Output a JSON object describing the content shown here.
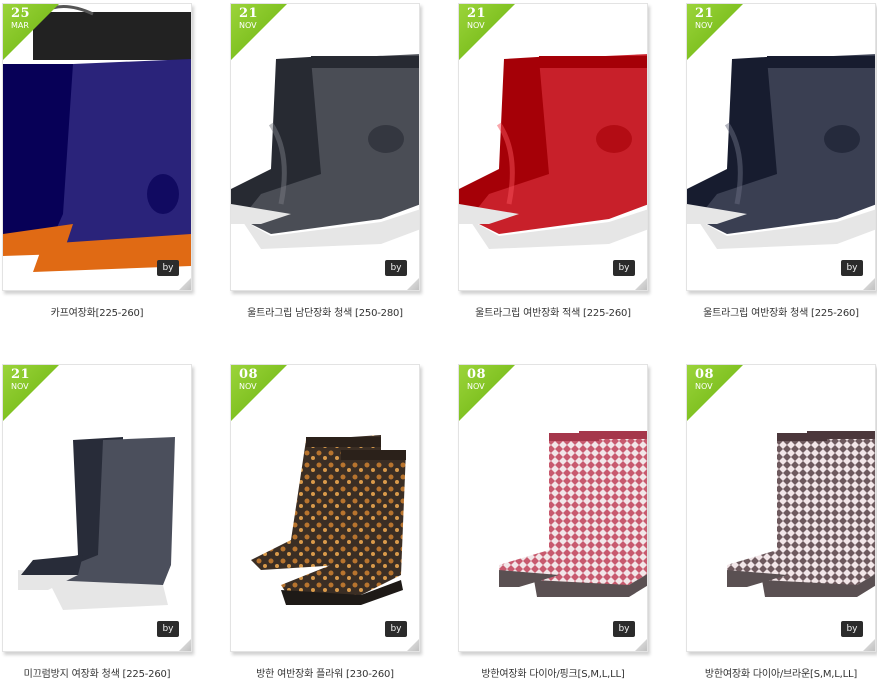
{
  "products": [
    {
      "day": "25",
      "month": "MAR",
      "by_label": "by",
      "title": "카프여장화[225-260]",
      "color": "#2a237a",
      "style": "mid-drawstring"
    },
    {
      "day": "21",
      "month": "NOV",
      "by_label": "by",
      "title": "울트라그립 남단장화 청색 [250-280]",
      "color": "#4a4d55",
      "style": "short"
    },
    {
      "day": "21",
      "month": "NOV",
      "by_label": "by",
      "title": "울트라그립 여반장화 적색 [225-260]",
      "color": "#c8202a",
      "style": "short"
    },
    {
      "day": "21",
      "month": "NOV",
      "by_label": "by",
      "title": "울트라그립 여반장화 청색 [225-260]",
      "color": "#3a3f52",
      "style": "short"
    },
    {
      "day": "21",
      "month": "NOV",
      "by_label": "by",
      "title": "미끄럼방지 여장화 청색 [225-260]",
      "color": "#4b4f5c",
      "style": "tall"
    },
    {
      "day": "08",
      "month": "NOV",
      "by_label": "by",
      "title": "방한 여반장화 플라워 [230-260]",
      "color": "#3b2e24",
      "style": "short-pattern"
    },
    {
      "day": "08",
      "month": "NOV",
      "by_label": "by",
      "title": "방한여장화 다이아/핑크[S,M,L,LL]",
      "color": "#c85a6e",
      "style": "tall-pattern"
    },
    {
      "day": "08",
      "month": "NOV",
      "by_label": "by",
      "title": "방한여장화 다이아/브라운[S,M,L,LL]",
      "color": "#6e5a5e",
      "style": "tall-pattern"
    }
  ]
}
